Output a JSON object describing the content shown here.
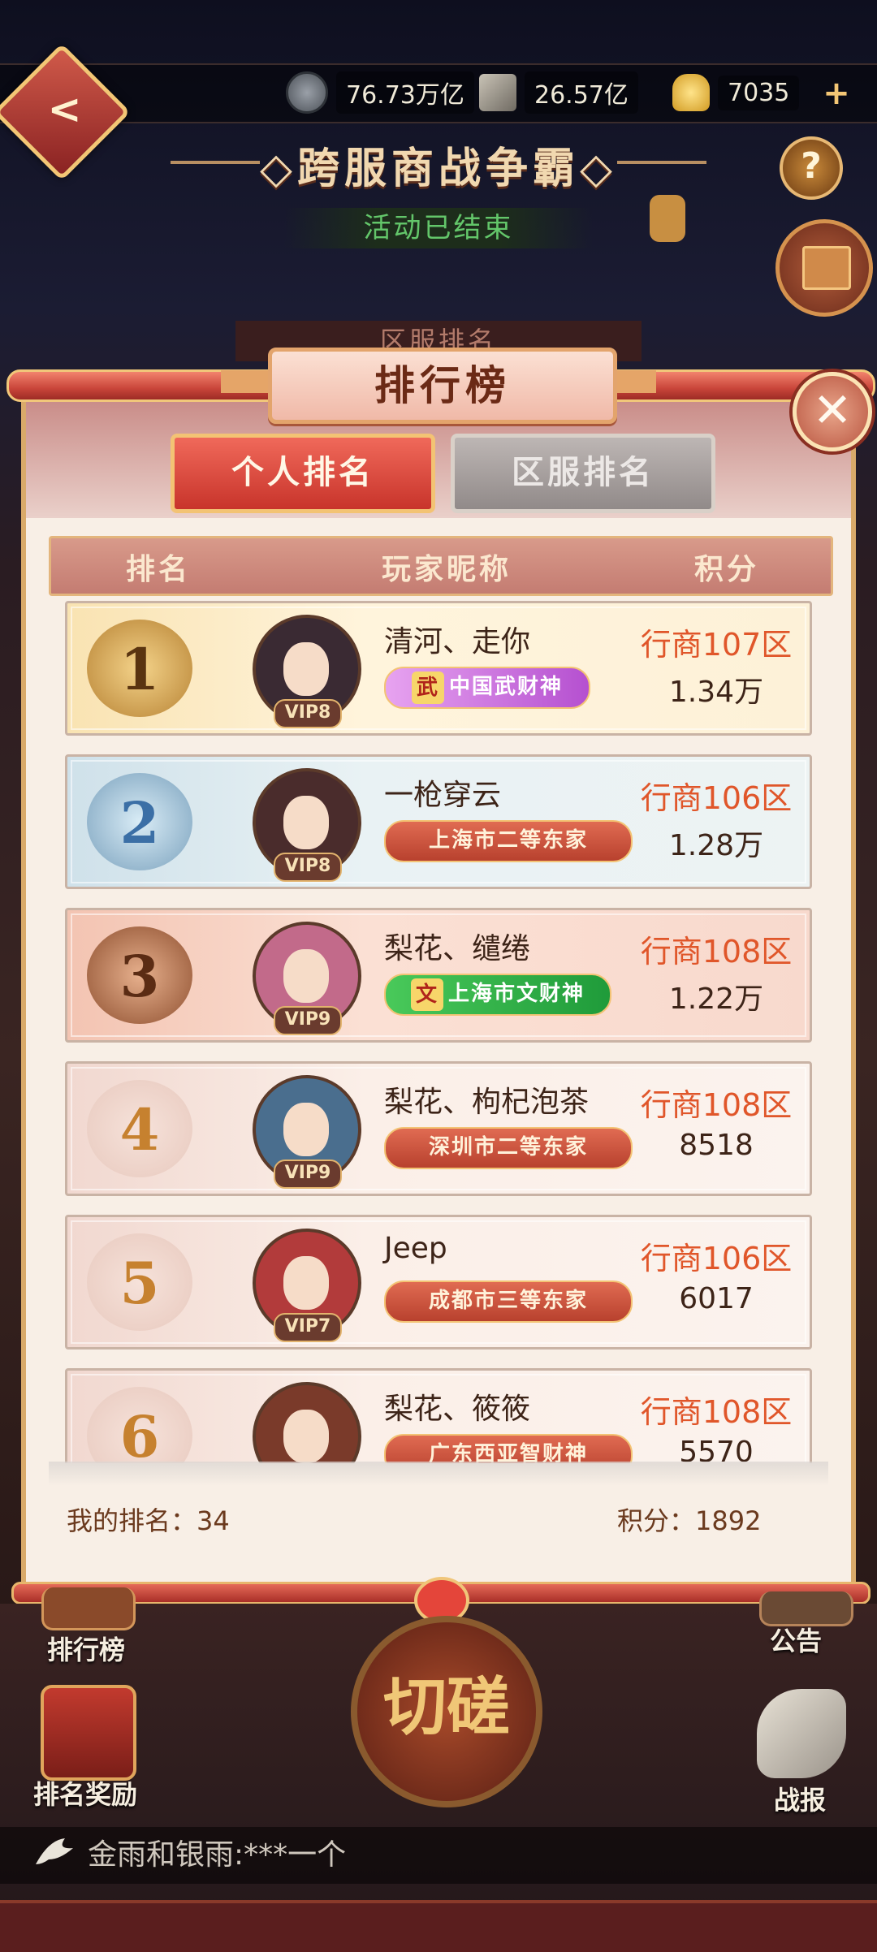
{
  "resources": [
    {
      "icon": "copper-coin-icon",
      "value": "76.73万亿"
    },
    {
      "icon": "scroll-book-icon",
      "value": "26.57亿"
    },
    {
      "icon": "gold-ingot-icon",
      "value": "7035"
    }
  ],
  "event": {
    "title": "◇跨服商战争霸◇",
    "status": "活动已结束",
    "behind_tab": "区服排名"
  },
  "panel": {
    "title": "排行榜",
    "tabs": {
      "personal": "个人排名",
      "server": "区服排名"
    },
    "headers": {
      "rank": "排名",
      "nickname": "玩家昵称",
      "score": "积分"
    },
    "rows": [
      {
        "rank": "1",
        "name": "清河、走你",
        "title": "中国武财神",
        "title_icon": "武",
        "vip": "VIP8",
        "server": "行商107区",
        "score": "1.34万",
        "theme": "gold"
      },
      {
        "rank": "2",
        "name": "一枪穿云",
        "title": "上海市二等东家",
        "title_icon": "",
        "vip": "VIP8",
        "server": "行商106区",
        "score": "1.28万",
        "theme": "silver"
      },
      {
        "rank": "3",
        "name": "梨花、缱绻",
        "title": "上海市文财神",
        "title_icon": "文",
        "vip": "VIP9",
        "server": "行商108区",
        "score": "1.22万",
        "theme": "bronze"
      },
      {
        "rank": "4",
        "name": "梨花、枸杞泡茶",
        "title": "深圳市二等东家",
        "title_icon": "",
        "vip": "VIP9",
        "server": "行商108区",
        "score": "8518",
        "theme": "plain"
      },
      {
        "rank": "5",
        "name": "Jeep",
        "title": "成都市三等东家",
        "title_icon": "",
        "vip": "VIP7",
        "server": "行商106区",
        "score": "6017",
        "theme": "plain"
      },
      {
        "rank": "6",
        "name": "梨花、筱筱",
        "title": "广东西亚智财神",
        "title_icon": "",
        "vip": "",
        "server": "行商108区",
        "score": "5570",
        "theme": "plain"
      }
    ],
    "my_rank_label": "我的排名：",
    "my_rank": "34",
    "my_score_label": "积分：",
    "my_score": "1892"
  },
  "bottom": {
    "ranking_btn": "排行榜",
    "reward_btn": "排名奖励",
    "notice_btn": "公告",
    "report_btn": "战报",
    "challenge_btn": "切磋",
    "marquee": "金雨和银雨:***一个"
  },
  "colors": {
    "accent_red": "#c8342b",
    "server_orange": "#e0562a",
    "gold_border": "#f3c374"
  }
}
